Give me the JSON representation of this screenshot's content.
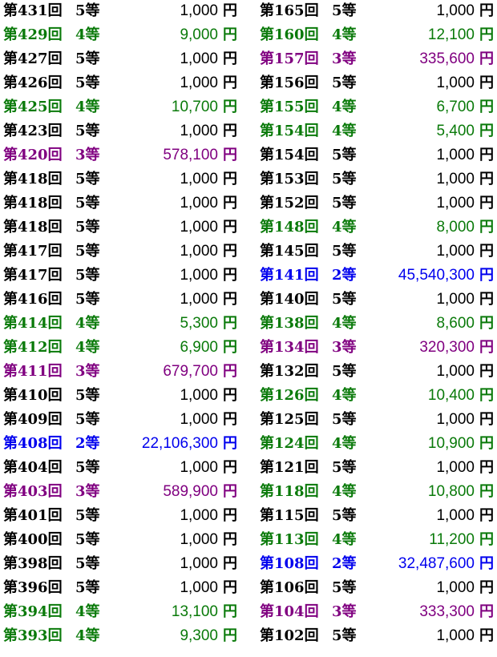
{
  "colors": {
    "2": "#0000ee",
    "3": "#800080",
    "4": "#0a7a0a",
    "5": "#000000"
  },
  "left": [
    {
      "draw": "第431回",
      "grade": "5等",
      "amount": "1,000",
      "yen": "円",
      "g": 5
    },
    {
      "draw": "第429回",
      "grade": "4等",
      "amount": "9,000",
      "yen": "円",
      "g": 4
    },
    {
      "draw": "第427回",
      "grade": "5等",
      "amount": "1,000",
      "yen": "円",
      "g": 5
    },
    {
      "draw": "第426回",
      "grade": "5等",
      "amount": "1,000",
      "yen": "円",
      "g": 5
    },
    {
      "draw": "第425回",
      "grade": "4等",
      "amount": "10,700",
      "yen": "円",
      "g": 4
    },
    {
      "draw": "第423回",
      "grade": "5等",
      "amount": "1,000",
      "yen": "円",
      "g": 5
    },
    {
      "draw": "第420回",
      "grade": "3等",
      "amount": "578,100",
      "yen": "円",
      "g": 3
    },
    {
      "draw": "第418回",
      "grade": "5等",
      "amount": "1,000",
      "yen": "円",
      "g": 5
    },
    {
      "draw": "第418回",
      "grade": "5等",
      "amount": "1,000",
      "yen": "円",
      "g": 5
    },
    {
      "draw": "第418回",
      "grade": "5等",
      "amount": "1,000",
      "yen": "円",
      "g": 5
    },
    {
      "draw": "第417回",
      "grade": "5等",
      "amount": "1,000",
      "yen": "円",
      "g": 5
    },
    {
      "draw": "第417回",
      "grade": "5等",
      "amount": "1,000",
      "yen": "円",
      "g": 5
    },
    {
      "draw": "第416回",
      "grade": "5等",
      "amount": "1,000",
      "yen": "円",
      "g": 5
    },
    {
      "draw": "第414回",
      "grade": "4等",
      "amount": "5,300",
      "yen": "円",
      "g": 4
    },
    {
      "draw": "第412回",
      "grade": "4等",
      "amount": "6,900",
      "yen": "円",
      "g": 4
    },
    {
      "draw": "第411回",
      "grade": "3等",
      "amount": "679,700",
      "yen": "円",
      "g": 3
    },
    {
      "draw": "第410回",
      "grade": "5等",
      "amount": "1,000",
      "yen": "円",
      "g": 5
    },
    {
      "draw": "第409回",
      "grade": "5等",
      "amount": "1,000",
      "yen": "円",
      "g": 5
    },
    {
      "draw": "第408回",
      "grade": "2等",
      "amount": "22,106,300",
      "yen": "円",
      "g": 2
    },
    {
      "draw": "第404回",
      "grade": "5等",
      "amount": "1,000",
      "yen": "円",
      "g": 5
    },
    {
      "draw": "第403回",
      "grade": "3等",
      "amount": "589,900",
      "yen": "円",
      "g": 3
    },
    {
      "draw": "第401回",
      "grade": "5等",
      "amount": "1,000",
      "yen": "円",
      "g": 5
    },
    {
      "draw": "第400回",
      "grade": "5等",
      "amount": "1,000",
      "yen": "円",
      "g": 5
    },
    {
      "draw": "第398回",
      "grade": "5等",
      "amount": "1,000",
      "yen": "円",
      "g": 5
    },
    {
      "draw": "第396回",
      "grade": "5等",
      "amount": "1,000",
      "yen": "円",
      "g": 5
    },
    {
      "draw": "第394回",
      "grade": "4等",
      "amount": "13,100",
      "yen": "円",
      "g": 4
    },
    {
      "draw": "第393回",
      "grade": "4等",
      "amount": "9,300",
      "yen": "円",
      "g": 4
    }
  ],
  "right": [
    {
      "draw": "第165回",
      "grade": "5等",
      "amount": "1,000",
      "yen": "円",
      "g": 5
    },
    {
      "draw": "第160回",
      "grade": "4等",
      "amount": "12,100",
      "yen": "円",
      "g": 4
    },
    {
      "draw": "第157回",
      "grade": "3等",
      "amount": "335,600",
      "yen": "円",
      "g": 3
    },
    {
      "draw": "第156回",
      "grade": "5等",
      "amount": "1,000",
      "yen": "円",
      "g": 5
    },
    {
      "draw": "第155回",
      "grade": "4等",
      "amount": "6,700",
      "yen": "円",
      "g": 4
    },
    {
      "draw": "第154回",
      "grade": "4等",
      "amount": "5,400",
      "yen": "円",
      "g": 4
    },
    {
      "draw": "第154回",
      "grade": "5等",
      "amount": "1,000",
      "yen": "円",
      "g": 5
    },
    {
      "draw": "第153回",
      "grade": "5等",
      "amount": "1,000",
      "yen": "円",
      "g": 5
    },
    {
      "draw": "第152回",
      "grade": "5等",
      "amount": "1,000",
      "yen": "円",
      "g": 5
    },
    {
      "draw": "第148回",
      "grade": "4等",
      "amount": "8,000",
      "yen": "円",
      "g": 4
    },
    {
      "draw": "第145回",
      "grade": "5等",
      "amount": "1,000",
      "yen": "円",
      "g": 5
    },
    {
      "draw": "第141回",
      "grade": "2等",
      "amount": "45,540,300",
      "yen": "円",
      "g": 2
    },
    {
      "draw": "第140回",
      "grade": "5等",
      "amount": "1,000",
      "yen": "円",
      "g": 5
    },
    {
      "draw": "第138回",
      "grade": "4等",
      "amount": "8,600",
      "yen": "円",
      "g": 4
    },
    {
      "draw": "第134回",
      "grade": "3等",
      "amount": "320,300",
      "yen": "円",
      "g": 3
    },
    {
      "draw": "第132回",
      "grade": "5等",
      "amount": "1,000",
      "yen": "円",
      "g": 5
    },
    {
      "draw": "第126回",
      "grade": "4等",
      "amount": "10,400",
      "yen": "円",
      "g": 4
    },
    {
      "draw": "第125回",
      "grade": "5等",
      "amount": "1,000",
      "yen": "円",
      "g": 5
    },
    {
      "draw": "第124回",
      "grade": "4等",
      "amount": "10,900",
      "yen": "円",
      "g": 4
    },
    {
      "draw": "第121回",
      "grade": "5等",
      "amount": "1,000",
      "yen": "円",
      "g": 5
    },
    {
      "draw": "第118回",
      "grade": "4等",
      "amount": "10,800",
      "yen": "円",
      "g": 4
    },
    {
      "draw": "第115回",
      "grade": "5等",
      "amount": "1,000",
      "yen": "円",
      "g": 5
    },
    {
      "draw": "第113回",
      "grade": "4等",
      "amount": "11,200",
      "yen": "円",
      "g": 4
    },
    {
      "draw": "第108回",
      "grade": "2等",
      "amount": "32,487,600",
      "yen": "円",
      "g": 2
    },
    {
      "draw": "第106回",
      "grade": "5等",
      "amount": "1,000",
      "yen": "円",
      "g": 5
    },
    {
      "draw": "第104回",
      "grade": "3等",
      "amount": "333,300",
      "yen": "円",
      "g": 3
    },
    {
      "draw": "第102回",
      "grade": "5等",
      "amount": "1,000",
      "yen": "円",
      "g": 5
    }
  ]
}
